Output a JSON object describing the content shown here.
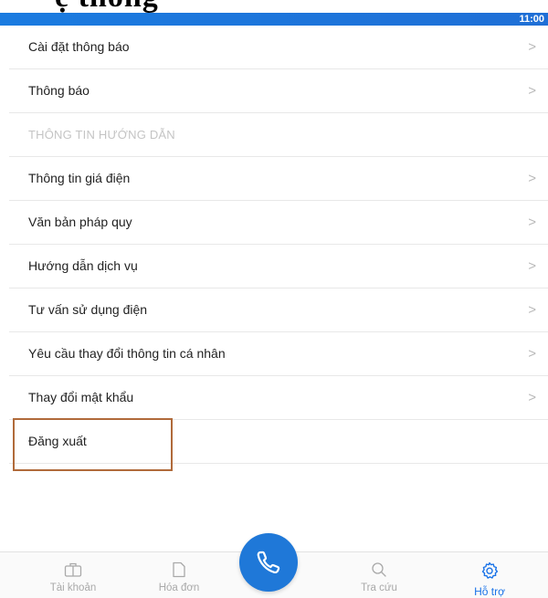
{
  "heading_fragment": "ệ thống",
  "status_bar": {
    "time": "11:00"
  },
  "menu": {
    "items_top": [
      {
        "label": "Cài đặt thông báo"
      },
      {
        "label": "Thông báo"
      }
    ],
    "section_header": "THÔNG TIN HƯỚNG DẪN",
    "items_bottom": [
      {
        "label": "Thông tin giá điện"
      },
      {
        "label": "Văn bản pháp quy"
      },
      {
        "label": "Hướng dẫn dịch vụ"
      },
      {
        "label": "Tư vấn sử dụng điện"
      },
      {
        "label": "Yêu cầu thay đổi thông tin cá nhân"
      },
      {
        "label": "Thay đổi mật khẩu"
      }
    ],
    "logout": {
      "label": "Đăng xuất"
    },
    "chevron": ">"
  },
  "bottom_nav": {
    "tabs": [
      {
        "label": "Tài khoản",
        "icon": "account-card-icon"
      },
      {
        "label": "Hóa đơn",
        "icon": "invoice-icon"
      },
      {
        "label": "Tra cứu",
        "icon": "search-icon"
      },
      {
        "label": "Hỗ trợ",
        "icon": "gear-icon",
        "active": true
      }
    ],
    "call_icon": "phone-icon"
  },
  "colors": {
    "accent": "#1a73e8",
    "status_bar": "#1a7be0",
    "highlight_border": "#b06a3a",
    "inactive": "#a9a9a9"
  }
}
